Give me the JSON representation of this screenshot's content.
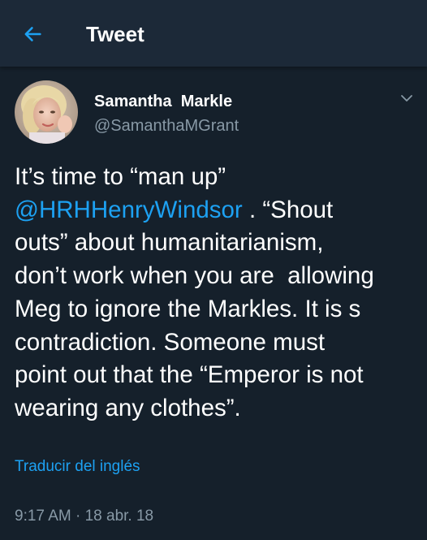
{
  "header": {
    "title": "Tweet",
    "back_icon": "arrow-left-icon"
  },
  "tweet": {
    "author": {
      "display_name": "Samantha  Markle",
      "handle": "@SamanthaMGrant"
    },
    "menu_icon": "chevron-down-icon",
    "text": {
      "line1": "It’s time to “man up”",
      "mention": "@HRHHenryWindsor",
      "line2_rest": " . “Shout",
      "line3": "outs” about humanitarianism,",
      "line4": "don’t work when you are  allowing",
      "line5": "Meg to ignore the Markles. It is s",
      "line6": "contradiction. Someone must",
      "line7": "point out that the “Emperor is not",
      "line8": "wearing any clothes”."
    },
    "translate_label": "Traducir del inglés",
    "time": "9:17 AM",
    "separator": " · ",
    "date": "18 abr. 18"
  },
  "colors": {
    "background": "#15202b",
    "header_background": "#1c2938",
    "accent": "#1da1f2",
    "secondary_text": "#8899a6",
    "primary_text": "#ffffff"
  }
}
